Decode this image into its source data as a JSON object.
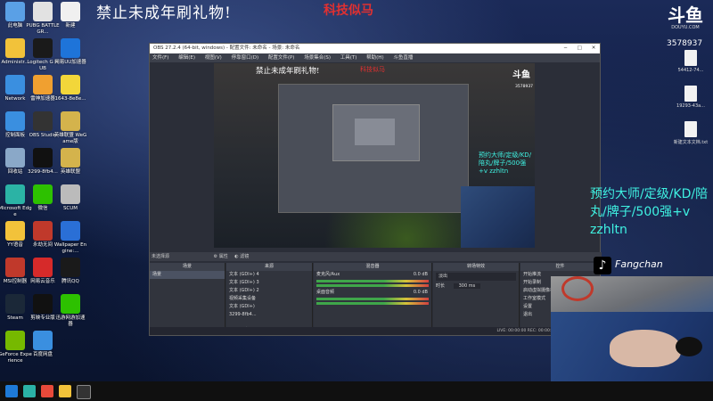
{
  "banner": "禁止未成年刷礼物!",
  "watermark": "科技似马",
  "douyu": {
    "logo": "斗鱼",
    "url": "DOUYU.COM",
    "room_id": "3578937"
  },
  "desktop_left": [
    {
      "label": "此电脑",
      "color": "#5aa0e6"
    },
    {
      "label": "PUBG BATTLEGR...",
      "color": "#e2e2e2"
    },
    {
      "label": "新建",
      "color": "#f0f0f0"
    },
    {
      "label": "Administr...",
      "color": "#f2c23a"
    },
    {
      "label": "Logitech G HUB",
      "color": "#1a1a1a"
    },
    {
      "label": "网易UU加速器",
      "color": "#1e74d9"
    },
    {
      "label": "Network",
      "color": "#3a8fe0"
    },
    {
      "label": "雷神加速器",
      "color": "#f0a030"
    },
    {
      "label": "1643-8e8e...",
      "color": "#f2d63a"
    },
    {
      "label": "控制面板",
      "color": "#3a8fe0"
    },
    {
      "label": "OBS Studio",
      "color": "#333"
    },
    {
      "label": "英雄联盟 WeGame版",
      "color": "#d4b34c"
    },
    {
      "label": "回收站",
      "color": "#8aa8c8"
    },
    {
      "label": "3299-8fb4...",
      "color": "#111"
    },
    {
      "label": "英雄联盟",
      "color": "#d4b34c"
    },
    {
      "label": "Microsoft Edge",
      "color": "#2bb3a5"
    },
    {
      "label": "微信",
      "color": "#2dc100"
    },
    {
      "label": "SCUM",
      "color": "#bbb"
    },
    {
      "label": "YY语音",
      "color": "#f2c23a"
    },
    {
      "label": "永劫无间",
      "color": "#c0392b"
    },
    {
      "label": "Wallpaper Engine:...",
      "color": "#2a6fd6"
    },
    {
      "label": "MSI控制器",
      "color": "#c0392b"
    },
    {
      "label": "网易云音乐",
      "color": "#d62a2a"
    },
    {
      "label": "腾讯QQ",
      "color": "#1a1a1a"
    },
    {
      "label": "Steam",
      "color": "#1b2838"
    },
    {
      "label": "剪映专业版",
      "color": "#111"
    },
    {
      "label": "迅游网游加速器",
      "color": "#2dc100"
    },
    {
      "label": "GeForce Experience",
      "color": "#76b900"
    },
    {
      "label": "百度网盘",
      "color": "#3a8fe0"
    }
  ],
  "desktop_right": [
    {
      "label": "54412-74..."
    },
    {
      "label": "19293-43a..."
    },
    {
      "label": "新建文本文档.txt"
    }
  ],
  "obs": {
    "title": "OBS 27.2.4 (64-bit, windows) - 配置文件: 未命名 - 场景: 未命名",
    "menu": [
      "文件(F)",
      "编辑(E)",
      "视图(V)",
      "停靠窗口(D)",
      "配置文件(P)",
      "场景集合(S)",
      "工具(T)",
      "帮助(H)",
      "斗鱼直播"
    ],
    "scene_bar": "未选择源",
    "scene_bar_buttons": [
      "属性",
      "滤镜"
    ],
    "docks": {
      "scenes": {
        "header": "场景",
        "items": [
          "场景"
        ]
      },
      "sources": {
        "header": "来源",
        "items": [
          "文本 (GDI+) 4",
          "文本 (GDI+) 3",
          "文本 (GDI+) 2",
          "视频采集设备",
          "文本 (GDI+)",
          "3299-8fb4..."
        ]
      },
      "mixer": {
        "header": "混音器",
        "tracks": [
          {
            "name": "麦克风/Aux",
            "db": "0.0 dB"
          },
          {
            "name": "桌面音频",
            "db": "0.0 dB"
          }
        ]
      },
      "transitions": {
        "header": "转场特效",
        "type": "淡出",
        "duration_label": "时长",
        "duration": "300 ms"
      },
      "controls": {
        "header": "控件",
        "items": [
          "开始推流",
          "开始录制",
          "启动虚拟摄像机",
          "工作室模式",
          "设置",
          "退出"
        ]
      }
    },
    "status": "LIVE: 00:00:00   REC: 00:00:00   CPU: 1.4%, 60.00 fps"
  },
  "cyan_text": "预约大师/定级/KD/陪丸/牌子/500强+v zzhltn",
  "tiktok_name": "Fangchan"
}
